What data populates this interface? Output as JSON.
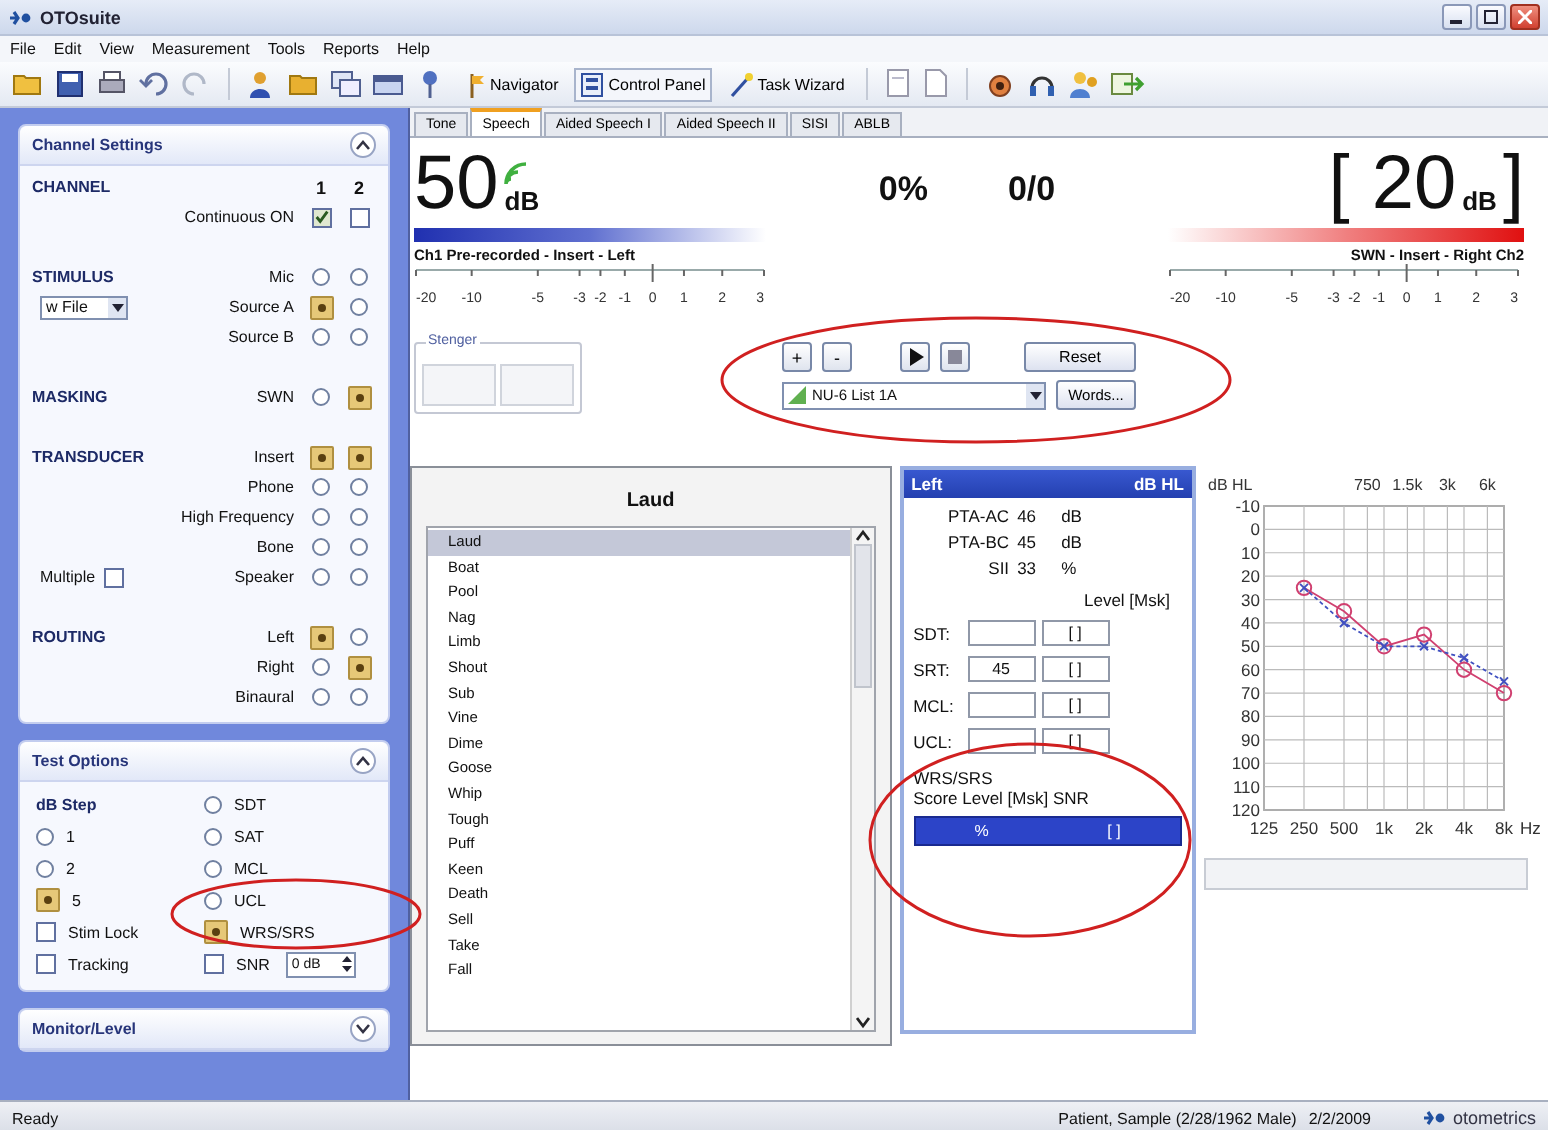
{
  "window": {
    "title": "OTOsuite"
  },
  "menu": [
    "File",
    "Edit",
    "View",
    "Measurement",
    "Tools",
    "Reports",
    "Help"
  ],
  "toolbar": {
    "buttons": [
      {
        "label": "Navigator"
      },
      {
        "label": "Control Panel"
      },
      {
        "label": "Task Wizard"
      }
    ]
  },
  "channel_settings": {
    "title": "Channel Settings",
    "expanded": true,
    "columns": [
      "1",
      "2"
    ],
    "sections": [
      {
        "heading": "CHANNEL",
        "rows": [
          {
            "label": "Continuous ON",
            "kind": "check",
            "ch1": true,
            "ch2": false
          }
        ]
      },
      {
        "heading": "STIMULUS",
        "rows": [
          {
            "label": "Mic",
            "kind": "radio",
            "ch1": false,
            "ch2": false
          },
          {
            "label": "Source A",
            "kind": "radio",
            "ch1": true,
            "ch2": false,
            "side": {
              "kind": "dropdown",
              "value": "w File"
            }
          },
          {
            "label": "Source B",
            "kind": "radio",
            "ch1": false,
            "ch2": false
          }
        ]
      },
      {
        "heading": "MASKING",
        "rows": [
          {
            "label": "SWN",
            "kind": "radio",
            "ch1": false,
            "ch2": true
          }
        ]
      },
      {
        "heading": "TRANSDUCER",
        "rows": [
          {
            "label": "Insert",
            "kind": "radio",
            "ch1": true,
            "ch2": true
          },
          {
            "label": "Phone",
            "kind": "radio",
            "ch1": false,
            "ch2": false
          },
          {
            "label": "High Frequency",
            "kind": "radio",
            "ch1": false,
            "ch2": false
          },
          {
            "label": "Bone",
            "kind": "radio",
            "ch1": false,
            "ch2": false
          },
          {
            "label": "Speaker",
            "kind": "radio",
            "ch1": false,
            "ch2": false,
            "side": {
              "kind": "checkbox",
              "label": "Multiple",
              "checked": false
            }
          }
        ]
      },
      {
        "heading": "ROUTING",
        "rows": [
          {
            "label": "Left",
            "kind": "radio",
            "ch1": true,
            "ch2": false
          },
          {
            "label": "Right",
            "kind": "radio",
            "ch1": false,
            "ch2": true
          },
          {
            "label": "Binaural",
            "kind": "radio",
            "ch1": false,
            "ch2": false
          }
        ]
      }
    ]
  },
  "test_options": {
    "title": "Test Options",
    "expanded": true,
    "columns": [
      [
        {
          "kind": "heading",
          "label": "dB Step"
        },
        {
          "kind": "radio",
          "label": "1",
          "selected": false
        },
        {
          "kind": "radio",
          "label": "2",
          "selected": false
        },
        {
          "kind": "radio",
          "label": "5",
          "selected": true
        },
        {
          "kind": "checkbox",
          "label": "Stim Lock",
          "checked": false
        },
        {
          "kind": "checkbox",
          "label": "Tracking",
          "checked": false
        }
      ],
      [
        {
          "kind": "radio",
          "label": "SDT",
          "selected": false
        },
        {
          "kind": "radio",
          "label": "SAT",
          "selected": false
        },
        {
          "kind": "radio",
          "label": "MCL",
          "selected": false
        },
        {
          "kind": "radio",
          "label": "UCL",
          "selected": false
        },
        {
          "kind": "radio",
          "label": "WRS/SRS",
          "selected": true
        },
        {
          "kind": "spin-check",
          "label": "SNR",
          "checked": false,
          "value": "0 dB"
        }
      ]
    ]
  },
  "monitor": {
    "title": "Monitor/Level",
    "expanded": false
  },
  "tabs": [
    {
      "label": "Tone",
      "selected": false
    },
    {
      "label": "Speech",
      "selected": true
    },
    {
      "label": "Aided Speech I",
      "selected": false
    },
    {
      "label": "Aided Speech II",
      "selected": false
    },
    {
      "label": "SISI",
      "selected": false
    },
    {
      "label": "ABLB",
      "selected": false
    }
  ],
  "channel1": {
    "value": "50",
    "unit": "dB",
    "label": "Ch1  Pre-recorded - Insert - Left",
    "ticks": [
      "-20",
      "-10",
      "-5",
      "-3",
      "-2",
      "-1",
      "0",
      "1",
      "2",
      "3"
    ]
  },
  "score": {
    "percent": "0%",
    "count": "0/0"
  },
  "channel2": {
    "open": "[",
    "value": "20",
    "unit": "dB",
    "close": "]",
    "label": "SWN - Insert - Right  Ch2",
    "ticks": [
      "-20",
      "-10",
      "-5",
      "-3",
      "-2",
      "-1",
      "0",
      "1",
      "2",
      "3"
    ]
  },
  "stenger": {
    "title": "Stenger"
  },
  "controls": {
    "buttons": [
      "+",
      "-"
    ],
    "reset": "Reset",
    "list": "NU-6 List 1A",
    "words": "Words..."
  },
  "word_panel": {
    "current": "Laud",
    "words": [
      {
        "text": "Laud",
        "selected": true
      },
      {
        "text": "Boat",
        "selected": false
      },
      {
        "text": "Pool",
        "selected": false
      },
      {
        "text": "Nag",
        "selected": false
      },
      {
        "text": "Limb",
        "selected": false
      },
      {
        "text": "Shout",
        "selected": false
      },
      {
        "text": "Sub",
        "selected": false
      },
      {
        "text": "Vine",
        "selected": false
      },
      {
        "text": "Dime",
        "selected": false
      },
      {
        "text": "Goose",
        "selected": false
      },
      {
        "text": "Whip",
        "selected": false
      },
      {
        "text": "Tough",
        "selected": false
      },
      {
        "text": "Puff",
        "selected": false
      },
      {
        "text": "Keen",
        "selected": false
      },
      {
        "text": "Death",
        "selected": false
      },
      {
        "text": "Sell",
        "selected": false
      },
      {
        "text": "Take",
        "selected": false
      },
      {
        "text": "Fall",
        "selected": false
      }
    ]
  },
  "results": {
    "side": "Left",
    "unit": "dB HL",
    "summary": [
      {
        "label": "PTA-AC",
        "value": "46",
        "unit": "dB"
      },
      {
        "label": "PTA-BC",
        "value": "45",
        "unit": "dB"
      },
      {
        "label": "SII",
        "value": "33",
        "unit": "%"
      }
    ],
    "level_header": "Level [Msk]",
    "thresholds": [
      {
        "label": "SDT:",
        "mask": "[ ]"
      },
      {
        "label": "SRT:",
        "level": "45",
        "mask": "[ ]"
      },
      {
        "label": "MCL:",
        "mask": "[ ]"
      },
      {
        "label": "UCL:",
        "mask": "[ ]"
      }
    ],
    "wrs": {
      "title": "WRS/SRS",
      "header": "Score Level [Msk] SNR",
      "score_unit": "%",
      "mask": "[ ]"
    }
  },
  "audiogram": {
    "top_labels": [
      "750",
      "1.5k",
      "3k",
      "6k"
    ],
    "chart_data": {
      "type": "line",
      "xlabel": "Hz",
      "ylabel": "dB HL",
      "categories": [
        "125",
        "250",
        "500",
        "1k",
        "2k",
        "4k",
        "8k"
      ],
      "series": [
        {
          "color": "#d04070",
          "marker": "circle",
          "line_style": "solid",
          "values": [
            null,
            25,
            35,
            50,
            45,
            60,
            70
          ]
        },
        {
          "color": "#4050c0",
          "marker": "cross",
          "line_style": "dashed",
          "values": [
            null,
            25,
            40,
            50,
            50,
            55,
            65
          ]
        }
      ],
      "grid": true,
      "ylim": [
        120,
        -10
      ],
      "yticks": [
        -10,
        0,
        10,
        20,
        30,
        40,
        50,
        60,
        70,
        80,
        90,
        100,
        110,
        120
      ]
    }
  },
  "status_bar": {
    "text": "Ready",
    "patient": "Patient, Sample (2/28/1962 Male)",
    "date": "2/2/2009",
    "brand": "otometrics"
  }
}
